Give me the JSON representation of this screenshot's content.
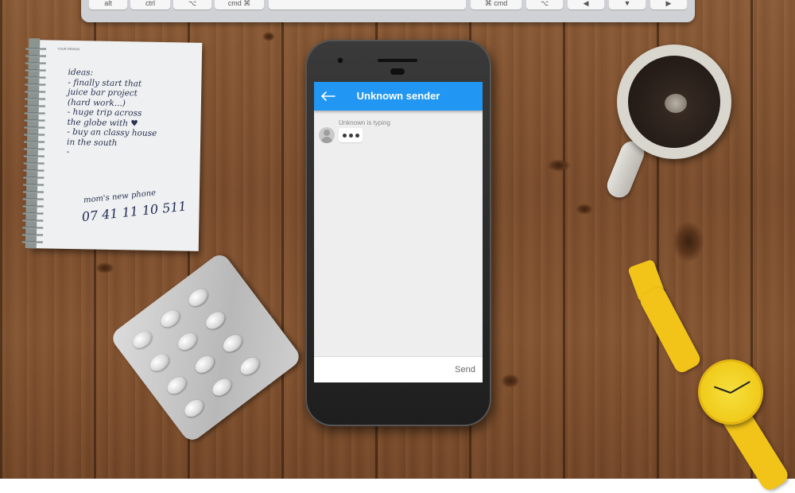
{
  "keyboard": {
    "keys": [
      "alt",
      "ctrl",
      "⌥",
      "cmd ⌘",
      "",
      "⌘ cmd",
      "⌥",
      "◀",
      "▼",
      "▶"
    ]
  },
  "notebook": {
    "brand": "YOUR DESIGN",
    "ideas_text": "ideas:\n- finally start that\njuice bar project\n      (hard work...)\n- huge trip across\nthe globe with ♥\n- buy an classy house\nin the south\n-",
    "phone_label": "mom's new phone",
    "phone_number": "07 41 11 10 511"
  },
  "chat": {
    "back_icon": "arrow-left-icon",
    "title": "Unknown sender",
    "typing_note": "Unknown is typing",
    "input_value": "",
    "input_placeholder": "",
    "send_label": "Send",
    "colors": {
      "appbar": "#2196f3",
      "background": "#eeeeee"
    }
  }
}
